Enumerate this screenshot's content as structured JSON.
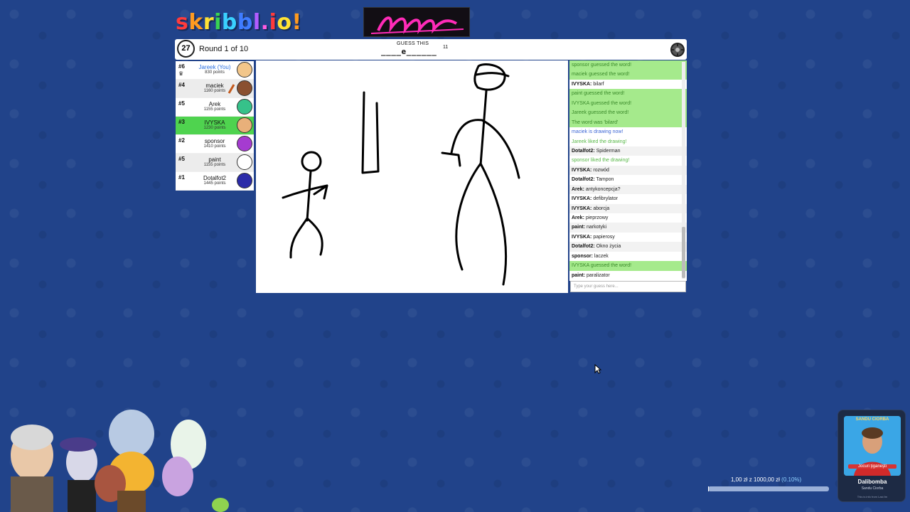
{
  "logo": [
    "s",
    "k",
    "r",
    "i",
    "b",
    "b",
    "l",
    ".",
    "i",
    "o",
    "!"
  ],
  "header": {
    "timer": "27",
    "round": "Round 1 of 10",
    "guess_label": "GUESS THIS",
    "word_hint": "____e______",
    "word_length": "11"
  },
  "players": [
    {
      "rank": "#6",
      "name": "Jareek (You)",
      "points": "830 points",
      "you": true,
      "crown": true,
      "avatar": "#f2c68a"
    },
    {
      "rank": "#4",
      "name": "maciek",
      "points": "1160 points",
      "drawing": true,
      "avatar": "#8a5030"
    },
    {
      "rank": "#5",
      "name": "Arek",
      "points": "1155 points",
      "avatar": "#36c28a"
    },
    {
      "rank": "#3",
      "name": "IVYSKA",
      "points": "1230 points",
      "guessed": true,
      "avatar": "#e8b07a"
    },
    {
      "rank": "#2",
      "name": "sponsor",
      "points": "1410 points",
      "avatar": "#a53bd0"
    },
    {
      "rank": "#5",
      "name": "paint",
      "points": "1155 points",
      "avatar": "#ffffff"
    },
    {
      "rank": "#1",
      "name": "Dotalfot2",
      "points": "1445 points",
      "avatar": "#2a2aa8"
    }
  ],
  "player_tooltip": "paralizator",
  "chat": [
    {
      "type": "g",
      "text": "sponsor guessed the word!"
    },
    {
      "type": "g",
      "text": "maciek guessed the word!"
    },
    {
      "type": "msg",
      "user": "IVYSKA:",
      "text": "bilarf"
    },
    {
      "type": "g",
      "text": "paint guessed the word!"
    },
    {
      "type": "g",
      "text": "IVYSKA guessed the word!"
    },
    {
      "type": "g",
      "text": "Jareek guessed the word!"
    },
    {
      "type": "g",
      "text": "The word was 'bilard'"
    },
    {
      "type": "sys",
      "text": "maciek is drawing now!"
    },
    {
      "type": "gl",
      "text": "Jareek liked the drawing!"
    },
    {
      "type": "msg",
      "user": "Dotalfot2:",
      "text": "Spiderman"
    },
    {
      "type": "gl",
      "text": "sponsor liked the drawing!"
    },
    {
      "type": "msg",
      "user": "IVYSKA:",
      "text": "rozwód"
    },
    {
      "type": "msg",
      "user": "Dotalfot2:",
      "text": "Tampon"
    },
    {
      "type": "msg",
      "user": "Arek:",
      "text": "antykoncepcja?"
    },
    {
      "type": "msg",
      "user": "IVYSKA:",
      "text": "defibrylator"
    },
    {
      "type": "msg",
      "user": "IVYSKA:",
      "text": "aborcja"
    },
    {
      "type": "msg",
      "user": "Arek:",
      "text": "pieprzowy"
    },
    {
      "type": "msg",
      "user": "paint:",
      "text": "narkotyki"
    },
    {
      "type": "msg",
      "user": "IVYSKA:",
      "text": "papierosy"
    },
    {
      "type": "msg",
      "user": "Dotalfot2:",
      "text": "Okno życia"
    },
    {
      "type": "msg",
      "user": "sponsor:",
      "text": "laczek"
    },
    {
      "type": "g",
      "text": "IVYSKA guessed the word!"
    },
    {
      "type": "msg",
      "user": "paint:",
      "text": "paralizator"
    }
  ],
  "chat_input_placeholder": "Type your guess here...",
  "donation": {
    "text": "1,00 zł z 1000,00 zł",
    "percent_text": "(0.10%)",
    "progress": 0.001
  },
  "card": {
    "top_text": "SANDU CIORBA",
    "photo_text": "Jocuri ţiganeşti",
    "name": "Dalibomba",
    "sub": "Sandu Ciorba",
    "tiny": "This is info from Last.fm"
  },
  "colors": {
    "background": "#21438a",
    "guessed_green": "#4fd34f",
    "chat_green": "#a5ea8c",
    "system_blue": "#3b65d4"
  }
}
